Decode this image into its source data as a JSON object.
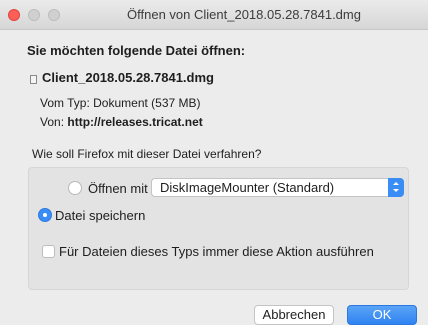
{
  "window": {
    "title": "Öffnen von Client_2018.05.28.7841.dmg"
  },
  "dialog": {
    "heading": "Sie möchten folgende Datei öffnen:",
    "file_name": "Client_2018.05.28.7841.dmg",
    "file_type": "Vom Typ: Dokument (537 MB)",
    "source_label": "Von:",
    "source_url": "http://releases.tricat.net",
    "question": "Wie soll Firefox mit dieser Datei verfahren?"
  },
  "options": {
    "open_with_label": "Öffnen mit",
    "open_with_checked": false,
    "open_with_app": "DiskImageMounter (Standard)",
    "save_file_label": "Datei speichern",
    "save_file_checked": true,
    "always_label": "Für Dateien dieses Typs immer diese Aktion ausführen",
    "always_checked": false
  },
  "buttons": {
    "cancel": "Abbrechen",
    "ok": "OK"
  },
  "colors": {
    "accent": "#3a8df5",
    "close": "#fc5f57"
  },
  "icons": {
    "file": "document-icon",
    "dropdown": "chevron-updown-icon"
  }
}
